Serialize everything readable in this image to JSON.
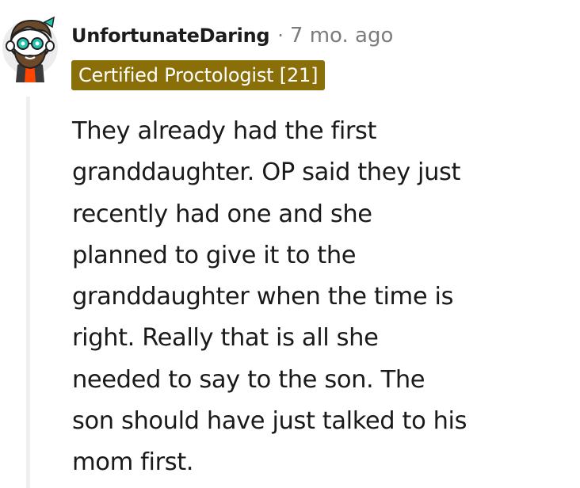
{
  "comment": {
    "author": {
      "username": "UnfortunateDaring",
      "avatar_icon": "snoo-avatar-icon",
      "flair": {
        "text": "Certified Proctologist [21]",
        "background": "#8a6f08",
        "color": "#ffffff"
      }
    },
    "separator": "·",
    "timestamp": "7 mo. ago",
    "body": "They already had the first\ngranddaughter. OP said they just\nrecently had one and she\nplanned to give it to the\ngranddaughter when the time is\nright. Really that is all she\nneeded to say to the son. The\nson should have just talked to his\nmom first."
  }
}
